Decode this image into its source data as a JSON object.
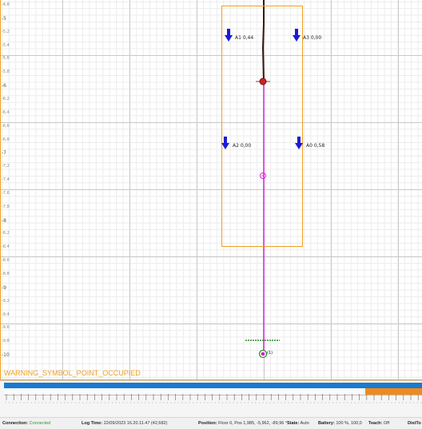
{
  "y_axis": {
    "ticks": [
      {
        "label": "-4,8",
        "major": false
      },
      {
        "label": "-5",
        "major": true
      },
      {
        "label": "-5,2",
        "major": false
      },
      {
        "label": "-5,4",
        "major": false
      },
      {
        "label": "-5,6",
        "major": false
      },
      {
        "label": "-5,8",
        "major": false
      },
      {
        "label": "-6",
        "major": true
      },
      {
        "label": "-6,2",
        "major": false
      },
      {
        "label": "-6,4",
        "major": false
      },
      {
        "label": "-6,6",
        "major": false
      },
      {
        "label": "-6,8",
        "major": false
      },
      {
        "label": "-7",
        "major": true
      },
      {
        "label": "-7,2",
        "major": false
      },
      {
        "label": "-7,4",
        "major": false
      },
      {
        "label": "-7,6",
        "major": false
      },
      {
        "label": "-7,8",
        "major": false
      },
      {
        "label": "-8",
        "major": true
      },
      {
        "label": "-8,2",
        "major": false
      },
      {
        "label": "-8,4",
        "major": false
      },
      {
        "label": "-8,6",
        "major": false
      },
      {
        "label": "-8,8",
        "major": false
      },
      {
        "label": "-9",
        "major": true
      },
      {
        "label": "-9,2",
        "major": false
      },
      {
        "label": "-9,4",
        "major": false
      },
      {
        "label": "-9,6",
        "major": false
      },
      {
        "label": "-9,8",
        "major": false
      },
      {
        "label": "-10",
        "major": true
      }
    ]
  },
  "antennas": {
    "a1": "A1 0,44",
    "a3": "A3 0,00",
    "a2": "A2 0,00",
    "a0": "A0 0,58"
  },
  "markers": {
    "end_point_label": "(1)"
  },
  "warning": "WARNING_SYMBOL_POINT_OCCUPIED",
  "colors": {
    "path": "#e020e0",
    "accent": "#f0a020",
    "arrow": "#1a1ae0",
    "progress": "#1a7ad0",
    "progress_highlight": "#f08a1a"
  },
  "status": {
    "connection_label": "Connection:",
    "connection_value": "Connected",
    "log_time_label": "Log Time:",
    "log_time_value": "22/09/2023 16.20.11.47 (42,682)",
    "position_label": "Position:",
    "position_value": "Floor 0, Pos 1,985, -5,962, -89,96 °",
    "state_label": "State:",
    "state_value": "Auto",
    "battery_label": "Battery:",
    "battery_value": "100 %, 100,0",
    "teach_label": "Teach:",
    "teach_value": "Off",
    "distto_label": "DistTo"
  }
}
